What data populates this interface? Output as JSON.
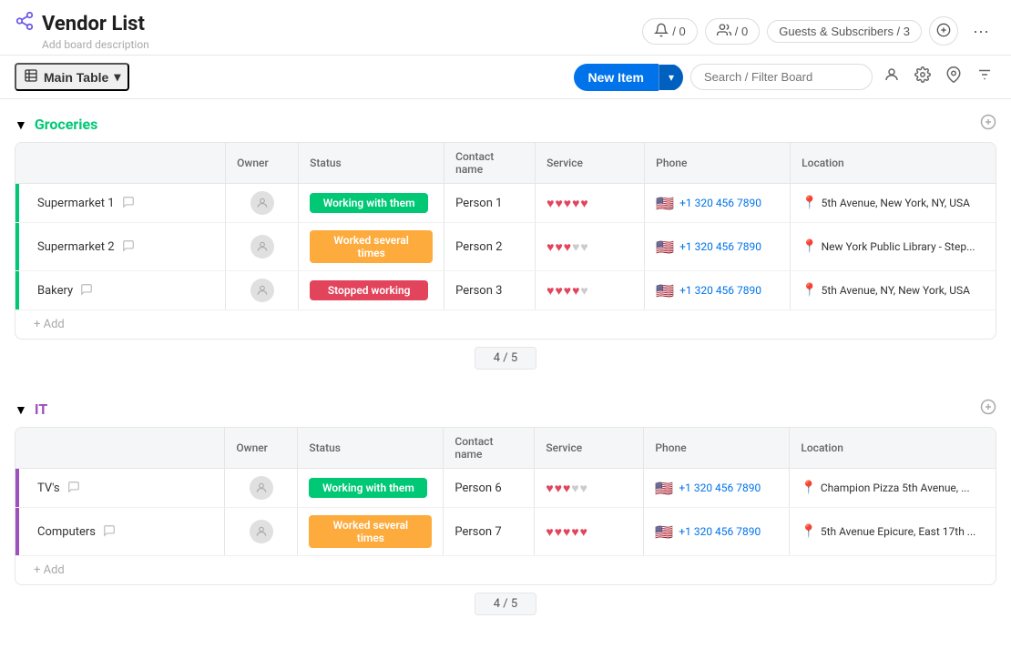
{
  "app": {
    "title": "Vendor List",
    "title_icon": "🔗",
    "board_description": "Add board description"
  },
  "header": {
    "activity_btn": "/ 0",
    "activity_icon": "🔔",
    "team_btn": "/ 0",
    "team_icon": "👥",
    "guests_label": "Guests & Subscribers / 3",
    "add_icon": "+",
    "more_icon": "···"
  },
  "toolbar": {
    "main_table_label": "Main Table",
    "new_item_label": "New Item",
    "search_placeholder": "Search / Filter Board"
  },
  "groups": [
    {
      "id": "groceries",
      "name": "Groceries",
      "color": "green",
      "columns": [
        "Owner",
        "Status",
        "Contact name",
        "Service",
        "Phone",
        "Location"
      ],
      "rows": [
        {
          "name": "Supermarket 1",
          "status": "Working with them",
          "status_class": "status-working",
          "contact": "Person 1",
          "hearts": 5,
          "phone": "+1 320 456 7890",
          "location": "5th Avenue, New York, NY, USA"
        },
        {
          "name": "Supermarket 2",
          "status": "Worked several times",
          "status_class": "status-worked",
          "contact": "Person 2",
          "hearts": 3,
          "phone": "+1 320 456 7890",
          "location": "New York Public Library - Step..."
        },
        {
          "name": "Bakery",
          "status": "Stopped working",
          "status_class": "status-stopped",
          "contact": "Person 3",
          "hearts": 4,
          "phone": "+1 320 456 7890",
          "location": "5th Avenue, NY, New York, USA"
        }
      ],
      "summary": "4 / 5"
    },
    {
      "id": "it",
      "name": "IT",
      "color": "purple",
      "columns": [
        "Owner",
        "Status",
        "Contact name",
        "Service",
        "Phone",
        "Location"
      ],
      "rows": [
        {
          "name": "TV's",
          "status": "Working with them",
          "status_class": "status-working",
          "contact": "Person 6",
          "hearts": 3,
          "phone": "+1 320 456 7890",
          "location": "Champion Pizza 5th Avenue, ..."
        },
        {
          "name": "Computers",
          "status": "Worked several times",
          "status_class": "status-worked",
          "contact": "Person 7",
          "hearts": 5,
          "phone": "+1 320 456 7890",
          "location": "5th Avenue Epicure, East 17th ..."
        }
      ],
      "summary": "4 / 5"
    }
  ]
}
